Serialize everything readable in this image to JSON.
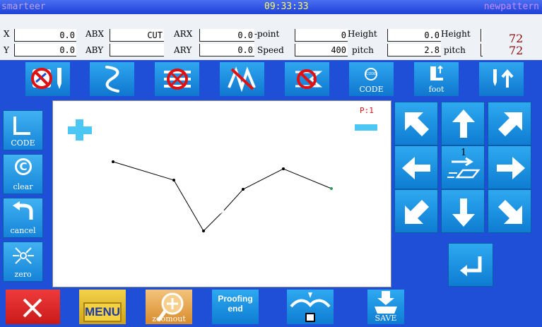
{
  "titlebar": {
    "left": "smarteer",
    "time": "09:33:33",
    "right": "newpattern"
  },
  "info": {
    "row1": {
      "x_label": "X",
      "x_value": "0.0",
      "abx_label": "ABX",
      "abx_value": "CUT",
      "arx_label": "ARX",
      "arx_value": "0.0",
      "point_label": "-point",
      "point_value": "0",
      "height_label": "Height",
      "height_value": "0.0",
      "height2_label": "Height",
      "height2_value": "72"
    },
    "row2": {
      "y_label": "Y",
      "y_value": "0.0",
      "aby_label": "ABY",
      "aby_value": "",
      "ary_label": "ARY",
      "ary_value": "0.0",
      "speed_label": "Speed",
      "speed_value": "400",
      "pitch_label": "pitch",
      "pitch_value": "2.8",
      "pitch2_label": "pitch",
      "pitch2_value": "72"
    }
  },
  "toolbar": {
    "code_label": "CODE",
    "code_icon_text": "CODE",
    "foot_label": "foot"
  },
  "canvas": {
    "page_label": "P:1"
  },
  "side": {
    "code": "CODE",
    "clear": "clear",
    "cancel": "cancel",
    "zero": "zero"
  },
  "pad": {
    "center_number": "1"
  },
  "bottom": {
    "menu": "MENU",
    "zoomout": "zoomout",
    "proofing1": "Proofing",
    "proofing2": "end",
    "save": "SAVE"
  },
  "colors": {
    "background": "#1e4fd6",
    "button": "#1a8fe0",
    "info_bg": "#eef1f6",
    "value_red": "#8a0d0d"
  }
}
